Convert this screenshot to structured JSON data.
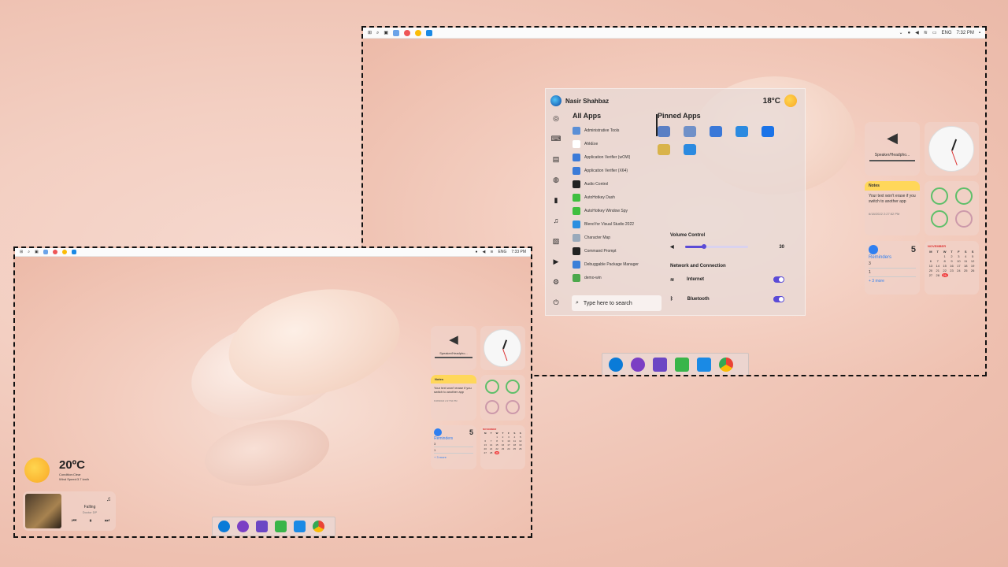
{
  "colors": {
    "accent": "#5b4bd6",
    "notes": "#ffd75a",
    "ring": "#5fbf6a",
    "edge": "#0a7bd8"
  },
  "top_screen": {
    "topbar": {
      "left_icons": [
        "windows-icon",
        "search-icon",
        "task-view-icon",
        "widgets-icon",
        "app-icon",
        "chrome-icon",
        "vscode-icon"
      ],
      "lang": "ENG",
      "time": "7:32 PM"
    },
    "start_menu": {
      "user_name": "Nasir Shahbaz",
      "temperature": "18°C",
      "all_apps_title": "All Apps",
      "pinned_title": "Pinned Apps",
      "apps": [
        {
          "label": "Administrative Tools",
          "color": "#5a8fd6"
        },
        {
          "label": "AhkExe",
          "color": "#ffffff"
        },
        {
          "label": "Application Verifier (wOW)",
          "color": "#3b7bd8"
        },
        {
          "label": "Application Verifier (X64)",
          "color": "#3b7bd8"
        },
        {
          "label": "Audio Control",
          "color": "#222222"
        },
        {
          "label": "AutoHotkey Dash",
          "color": "#3fbf3f"
        },
        {
          "label": "AutoHotkey Window Spy",
          "color": "#3fbf3f"
        },
        {
          "label": "Blend for Visual Studio 2022",
          "color": "#2a8fe0"
        },
        {
          "label": "Character Map",
          "color": "#9ab"
        },
        {
          "label": "Command Prompt",
          "color": "#222222"
        },
        {
          "label": "Debuggable Package Manager",
          "color": "#3a7fd8"
        },
        {
          "label": "demo-win",
          "color": "#4ca84c"
        }
      ],
      "pinned_colors": [
        "#5b7fc4",
        "#7090c8",
        "#3a78d8",
        "#2b8ae0",
        "#1a73e8",
        "#d9b34a",
        "#2b8ae0"
      ],
      "search_placeholder": "Type here to search",
      "volume_title": "Volume Control",
      "volume_value": "30",
      "volume_level": 0.3,
      "network_title": "Network and Connection",
      "internet_label": "Internet",
      "bluetooth_label": "Bluetooth"
    },
    "widgets": {
      "audio_label": "Speaker/Headpho...",
      "notes_title": "Notes",
      "notes_text": "Your text won't erase if you switch to another app",
      "notes_date": "6/18/2022 2:27:52 PM",
      "reminders_count": "5",
      "reminders_title": "Reminders",
      "reminders_items": [
        "3",
        "1"
      ],
      "reminders_more": "+ 3 more",
      "calendar_month": "NOVEMBER",
      "calendar_days": [
        "M",
        "T",
        "W",
        "T",
        "F",
        "S",
        "S"
      ],
      "calendar_dates": [
        "",
        "",
        "1",
        "2",
        "3",
        "4",
        "5",
        "6",
        "7",
        "8",
        "9",
        "10",
        "11",
        "12",
        "13",
        "14",
        "15",
        "16",
        "17",
        "18",
        "19",
        "20",
        "21",
        "22",
        "23",
        "24",
        "25",
        "26",
        "27",
        "28",
        "29"
      ]
    }
  },
  "bottom_screen": {
    "topbar": {
      "lang": "ENG",
      "time": "7:33 PM"
    },
    "weather": {
      "temp": "20ºC",
      "condition": "Condition:Clear",
      "wind": "Wind Speed:3.7 km/h"
    },
    "music": {
      "song": "Falling",
      "artist": "Doctor DP"
    },
    "widgets": {
      "audio_label": "Speaker/Headpho...",
      "notes_title": "Notes",
      "notes_text": "Your text won't erase if you switch to another app",
      "notes_date": "6/18/2022 2:27:52 PM",
      "reminders_count": "5",
      "reminders_title": "Reminders",
      "reminders_items": [
        "3",
        "1"
      ],
      "reminders_more": "+ 3 more",
      "calendar_month": "NOVEMBER"
    }
  },
  "dock_icons": [
    "edge-icon",
    "github-icon",
    "visual-studio-icon",
    "autohotkey-icon",
    "vscode-icon",
    "chrome-icon"
  ]
}
